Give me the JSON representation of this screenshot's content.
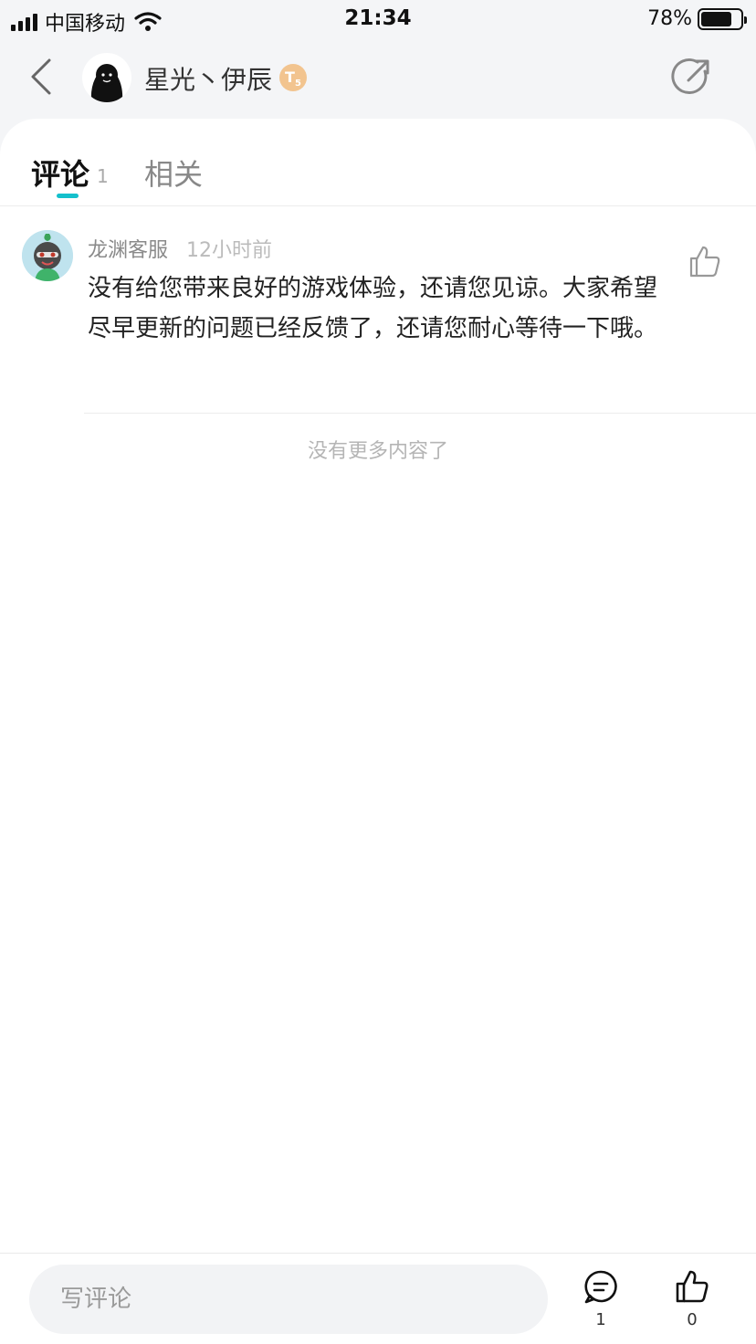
{
  "status_bar": {
    "carrier": "中国移动",
    "time": "21:34",
    "battery": "78%",
    "battery_level": 0.78
  },
  "header": {
    "author_name": "星光丶伊辰",
    "level_badge": "T",
    "level_sub": "5"
  },
  "tabs": [
    {
      "label": "评论",
      "count": "1"
    },
    {
      "label": "相关"
    }
  ],
  "comments": [
    {
      "user": "龙渊客服",
      "time": "12小时前",
      "text": "没有给您带来良好的游戏体验，还请您见谅。大家希望尽早更新的问题已经反馈了，还请您耐心等待一下哦。"
    }
  ],
  "end_text": "没有更多内容了",
  "bottom_bar": {
    "input_placeholder": "写评论",
    "comment_count": "1",
    "like_count": "0"
  },
  "colors": {
    "accent": "#14c0cc",
    "badge": "#f2c48f"
  }
}
